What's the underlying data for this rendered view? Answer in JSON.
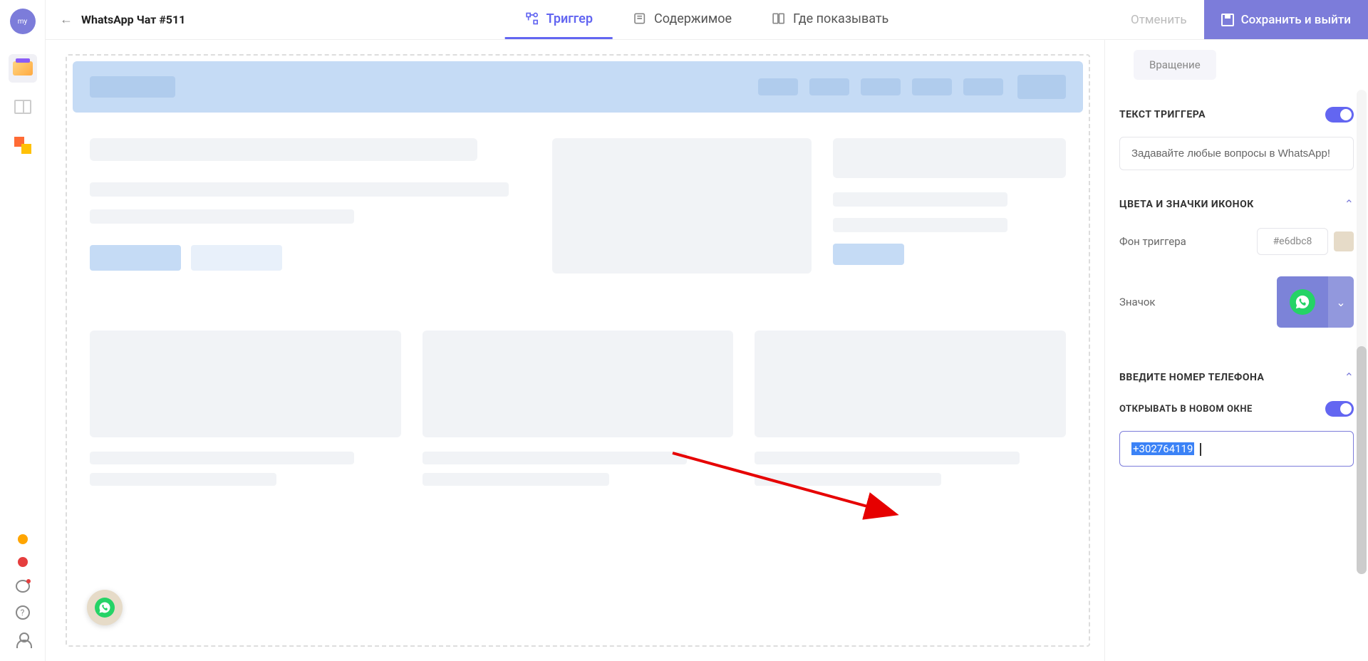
{
  "avatar": {
    "initials": "my"
  },
  "page": {
    "title": "WhatsApp Чат #511"
  },
  "tabs": {
    "trigger": "Триггер",
    "content": "Содержимое",
    "display": "Где показывать"
  },
  "header_actions": {
    "cancel": "Отменить",
    "save": "Сохранить и выйти"
  },
  "panel": {
    "rotation": "Вращение",
    "trigger_text_heading": "ТЕКСТ ТРИГГЕРА",
    "trigger_text_value": "Задавайте любые вопросы в WhatsApp!",
    "colors_heading": "ЦВЕТА И ЗНАЧКИ ИКОНОК",
    "bg_label": "Фон триггера",
    "bg_hex": "#e6dbc8",
    "icon_label": "Значок",
    "phone_heading": "ВВЕДИТЕ НОМЕР ТЕЛЕФОНА",
    "open_new_window": "ОТКРЫВАТЬ В НОВОМ ОКНЕ",
    "phone_value": "+302764119"
  }
}
